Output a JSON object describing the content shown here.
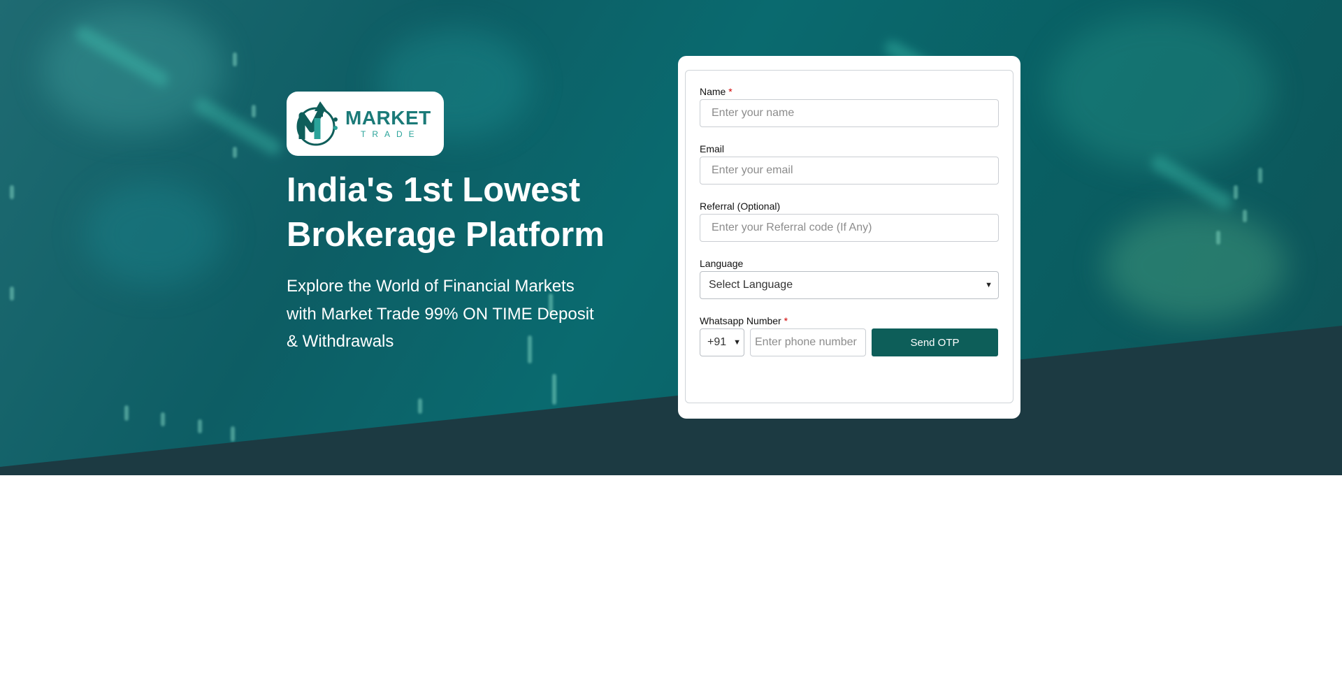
{
  "logo": {
    "title": "MARKET",
    "subtitle": "TRADE"
  },
  "hero": {
    "headline": "India's 1st Lowest Brokerage Platform",
    "subheadline": "Explore the World of Financial Markets with Market Trade 99% ON TIME Deposit & Withdrawals"
  },
  "form": {
    "name": {
      "label": "Name",
      "required_mark": "*",
      "placeholder": "Enter your name"
    },
    "email": {
      "label": "Email",
      "placeholder": "Enter your email"
    },
    "referral": {
      "label": "Referral (Optional)",
      "placeholder": "Enter your Referral code (If Any)"
    },
    "language": {
      "label": "Language",
      "selected": "Select Language"
    },
    "whatsapp": {
      "label": "Whatsapp Number",
      "required_mark": "*",
      "country_code": "+91",
      "placeholder": "Enter phone number"
    },
    "send_otp_label": "Send OTP"
  },
  "icons": {
    "logo_mark": "market-trade-logo-icon",
    "dropdown": "chevron-down-icon"
  },
  "colors": {
    "brand_dark": "#0d5e59",
    "hero_band": "#1c3a42",
    "required": "#d10000"
  }
}
